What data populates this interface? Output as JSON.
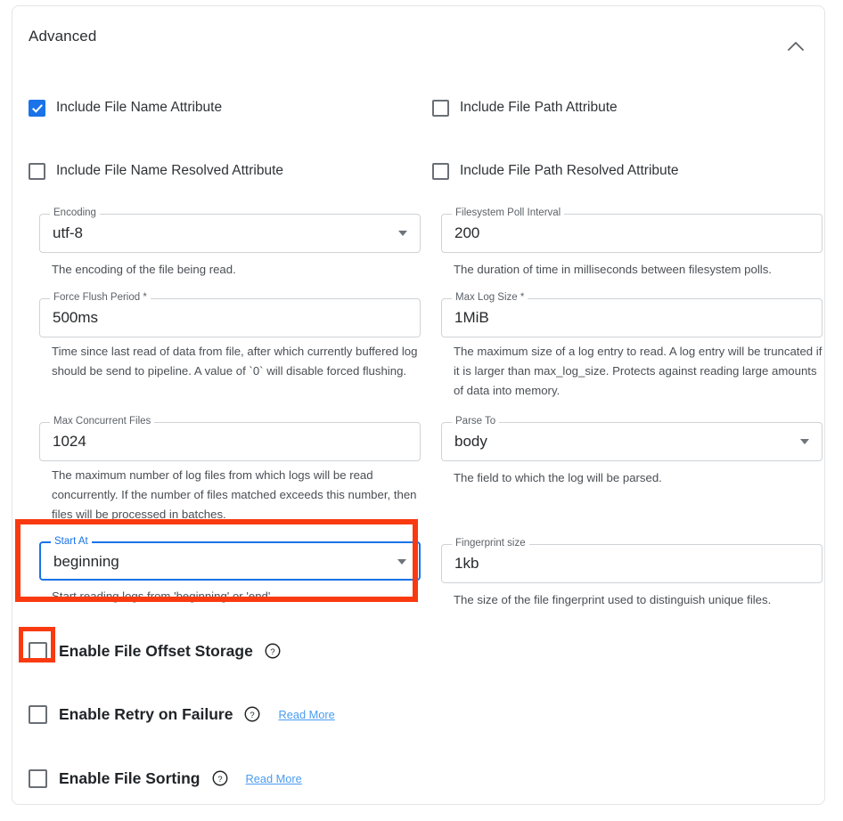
{
  "panel": {
    "title": "Advanced",
    "collapse_icon": "chevron-up-icon"
  },
  "checkbox_rows": [
    {
      "label": "Include File Name Attribute",
      "checked": true,
      "column": "left"
    },
    {
      "label": "Include File Path Attribute",
      "checked": false,
      "column": "right"
    },
    {
      "label": "Include File Name Resolved Attribute",
      "checked": false,
      "column": "left"
    },
    {
      "label": "Include File Path Resolved Attribute",
      "checked": false,
      "column": "right"
    }
  ],
  "fields": {
    "encoding": {
      "label": "Encoding",
      "value": "utf-8",
      "type": "select",
      "helper": "The encoding of the file being read.",
      "focused": false
    },
    "filesystem_poll_interval": {
      "label": "Filesystem Poll Interval",
      "value": "200",
      "type": "text",
      "helper": "The duration of time in milliseconds between filesystem polls.",
      "focused": false
    },
    "force_flush_period": {
      "label": "Force Flush Period *",
      "value": "500ms",
      "type": "text",
      "helper": "Time since last read of data from file, after which currently buffered log should be send to pipeline. A value of `0` will disable forced flushing.",
      "focused": false
    },
    "max_log_size": {
      "label": "Max Log Size *",
      "value": "1MiB",
      "type": "text",
      "helper": "The maximum size of a log entry to read. A log entry will be truncated if it is larger than max_log_size. Protects against reading large amounts of data into memory.",
      "focused": false
    },
    "max_concurrent_files": {
      "label": "Max Concurrent Files",
      "value": "1024",
      "type": "text",
      "helper": "The maximum number of log files from which logs will be read concurrently. If the number of files matched exceeds this number, then files will be processed in batches.",
      "focused": false
    },
    "parse_to": {
      "label": "Parse To",
      "value": "body",
      "type": "select",
      "helper": "The field to which the log will be parsed.",
      "focused": false
    },
    "start_at": {
      "label": "Start At",
      "value": "beginning",
      "type": "select",
      "helper": "Start reading logs from 'beginning' or 'end'.",
      "focused": true
    },
    "fingerprint_size": {
      "label": "Fingerprint size",
      "value": "1kb",
      "type": "text",
      "helper": "The size of the file fingerprint used to distinguish unique files.",
      "focused": false
    }
  },
  "toggles": [
    {
      "label": "Enable File Offset Storage",
      "checked": false,
      "help_icon": "question-mark-circle-icon",
      "read_more": ""
    },
    {
      "label": "Enable Retry on Failure",
      "checked": false,
      "help_icon": "question-mark-circle-icon",
      "read_more": "Read More"
    },
    {
      "label": "Enable File Sorting",
      "checked": false,
      "help_icon": "question-mark-circle-icon",
      "read_more": "Read More"
    }
  ],
  "annotations": {
    "highlight_color": "#f93a10",
    "targets": [
      "start-at-field",
      "enable-file-offset-storage-checkbox"
    ]
  },
  "colors": {
    "accent_blue": "#1a73e8",
    "link_blue": "#4a9bf0",
    "border_grey": "#cfd3d7",
    "text_primary": "#26292c"
  }
}
